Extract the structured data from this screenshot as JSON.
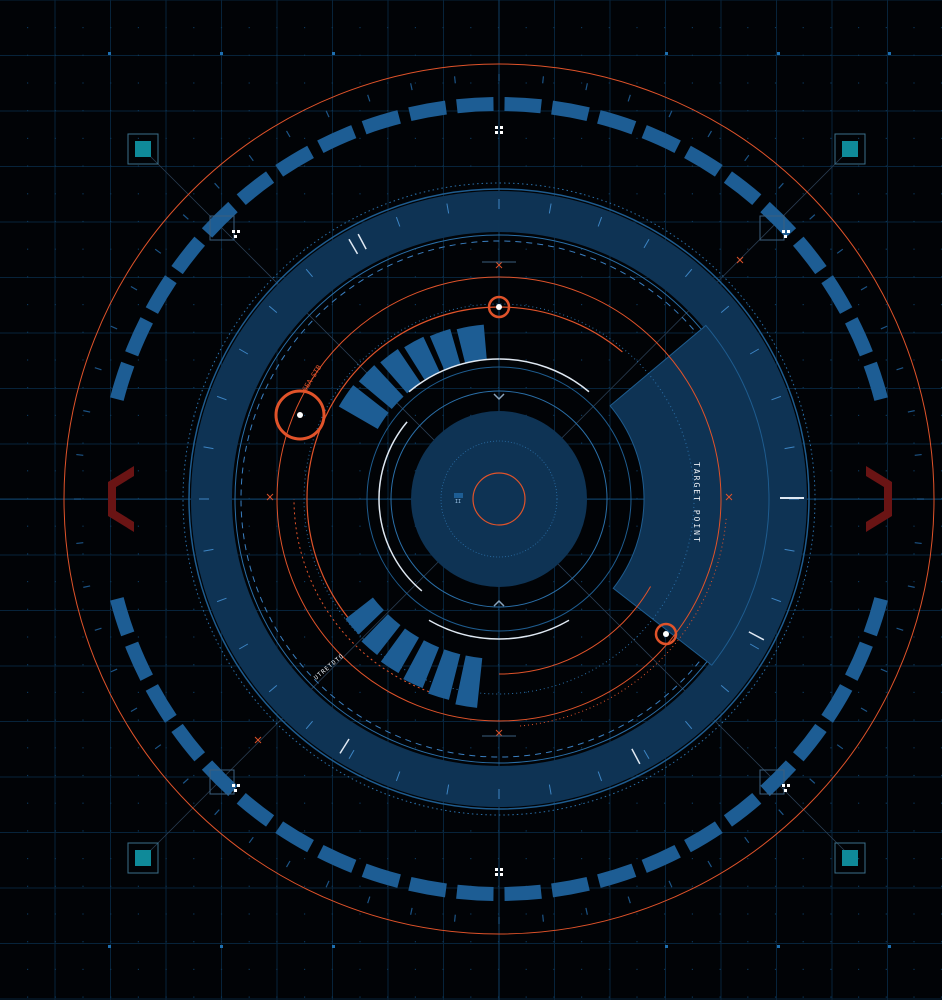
{
  "labels": {
    "target_point": "TARGET POINT",
    "upper_left_code": "6EA-STB",
    "lower_left_code": "UTRETDTO",
    "center_marker": "II"
  },
  "colors": {
    "background": "#010306",
    "panel_blue": "#0e3354",
    "bright_blue": "#1d5d94",
    "grid_blue": "#0a2a44",
    "accent_orange": "#e0532a",
    "dark_red": "#5a1010",
    "teal": "#0f8a99",
    "white": "#e8eef4"
  },
  "icons": {
    "left_chevron": "chevron-left-icon",
    "right_chevron": "chevron-right-icon",
    "corner_markers": "teal-square-icon",
    "target_circles": "target-ring-icon"
  }
}
